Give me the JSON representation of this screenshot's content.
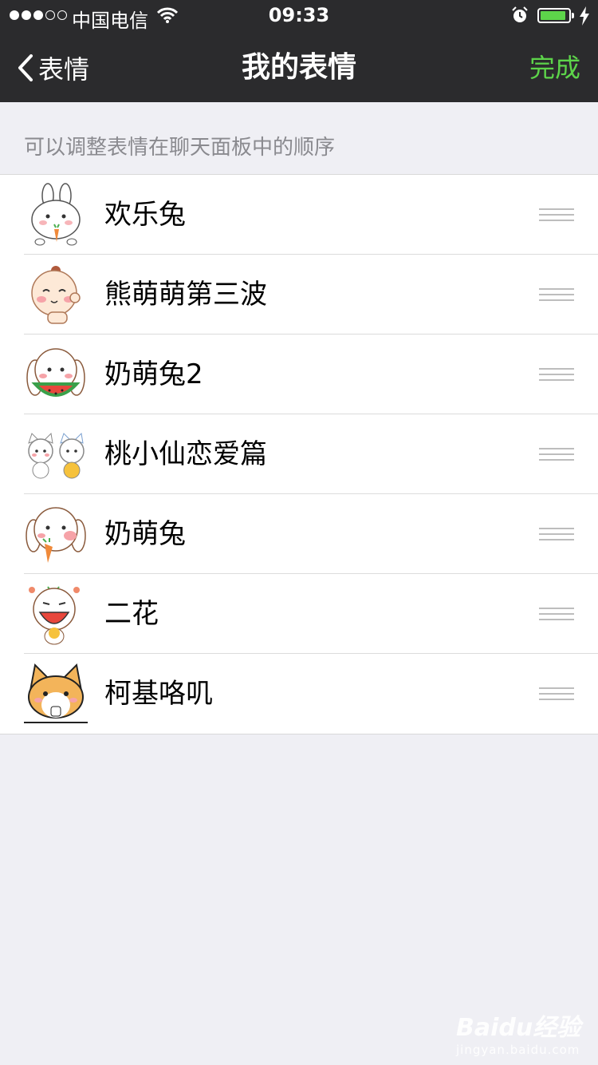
{
  "status_bar": {
    "carrier": "中国电信",
    "time": "09:33",
    "battery_level": 0.9
  },
  "nav": {
    "back_label": "表情",
    "title": "我的表情",
    "done_label": "完成"
  },
  "hint": "可以调整表情在聊天面板中的顺序",
  "stickers": [
    {
      "name": "欢乐兔",
      "icon": "bunny-carrot-sticker-icon"
    },
    {
      "name": "熊萌萌第三波",
      "icon": "baby-sticker-icon"
    },
    {
      "name": "奶萌兔2",
      "icon": "bunny-watermelon-sticker-icon"
    },
    {
      "name": "桃小仙恋爱篇",
      "icon": "cat-couple-sticker-icon"
    },
    {
      "name": "奶萌兔",
      "icon": "bunny-eating-sticker-icon"
    },
    {
      "name": "二花",
      "icon": "crying-girl-sticker-icon"
    },
    {
      "name": "柯基咯叽",
      "icon": "corgi-sticker-icon"
    }
  ],
  "watermark": {
    "main": "Baidu经验",
    "sub": "jingyan.baidu.com"
  },
  "colors": {
    "accent": "#5dd44a",
    "nav_bg": "#2b2b2d",
    "page_bg": "#efeff4"
  }
}
